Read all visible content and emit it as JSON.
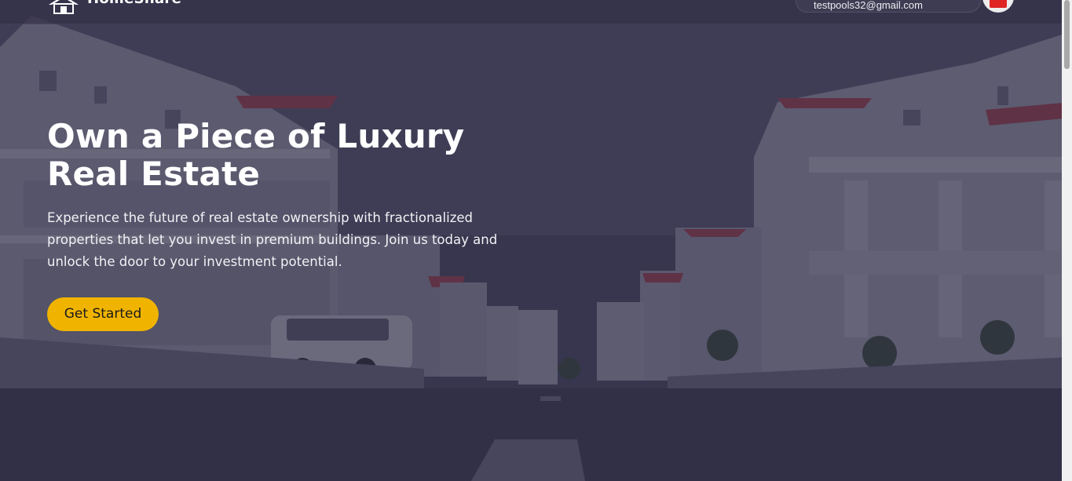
{
  "nav": {
    "brand": "HomeShare",
    "email": "testpools32@gmail.com"
  },
  "hero": {
    "title": "Own a Piece of Luxury Real Estate",
    "subtitle": "Experience the future of real estate ownership with fractionalized properties that let you invest in premium buildings. Join us today and unlock the door to your investment potential.",
    "cta_label": "Get Started"
  },
  "colors": {
    "accent": "#f0b400",
    "overlay": "#2f2e44",
    "text": "#ffffff"
  },
  "icons": {
    "logo": "house-logo-icon",
    "avatar": "user-avatar-icon"
  }
}
